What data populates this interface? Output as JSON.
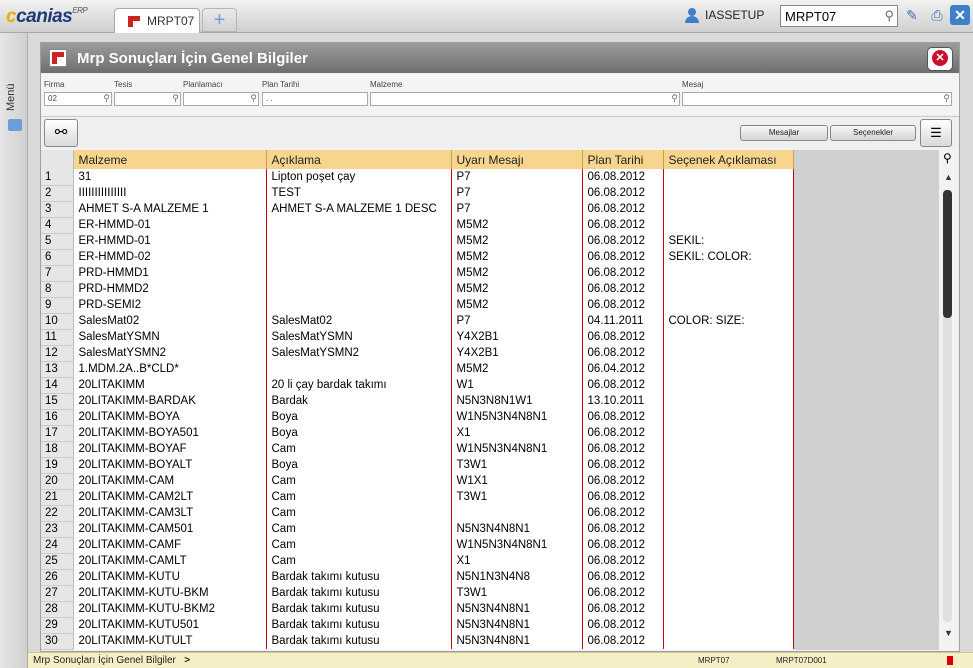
{
  "app": {
    "logo_main": "canias",
    "logo_sup": "ERP"
  },
  "tabs": [
    {
      "label": "MRPT07"
    }
  ],
  "add_tab_label": "+",
  "top": {
    "user": "IASSETUP",
    "search_value": "MRPT07"
  },
  "sidebar": {
    "menu_label": "Menü"
  },
  "window": {
    "title": "Mrp Sonuçları İçin Genel Bilgiler"
  },
  "filters": [
    {
      "label": "Firma",
      "value": "02"
    },
    {
      "label": "Tesis",
      "value": ""
    },
    {
      "label": "Planlamacı",
      "value": ""
    },
    {
      "label": "Plan Tarihi",
      "value": ". ."
    },
    {
      "label": "Malzeme",
      "value": ""
    },
    {
      "label": "Mesaj",
      "value": ""
    }
  ],
  "toolbar": {
    "messages_label": "Mesajlar",
    "options_label": "Seçenekler"
  },
  "grid": {
    "columns": [
      "",
      "Malzeme",
      "Açıklama",
      "Uyarı Mesajı",
      "Plan Tarihi",
      "Seçenek Açıklaması"
    ],
    "rows": [
      [
        "1",
        "31",
        "Lipton poşet çay",
        "P7",
        "06.08.2012",
        ""
      ],
      [
        "2",
        "IIIIIIIIIIIIIII",
        "TEST",
        "P7",
        "06.08.2012",
        ""
      ],
      [
        "3",
        "AHMET S-A MALZEME 1",
        "AHMET S-A MALZEME 1 DESC",
        "P7",
        "06.08.2012",
        ""
      ],
      [
        "4",
        "ER-HMMD-01",
        "",
        "M5M2",
        "06.08.2012",
        ""
      ],
      [
        "5",
        "ER-HMMD-01",
        "",
        "M5M2",
        "06.08.2012",
        "SEKIL:"
      ],
      [
        "6",
        "ER-HMMD-02",
        "",
        "M5M2",
        "06.08.2012",
        "SEKIL:   COLOR:"
      ],
      [
        "7",
        "PRD-HMMD1",
        "",
        "M5M2",
        "06.08.2012",
        ""
      ],
      [
        "8",
        "PRD-HMMD2",
        "",
        "M5M2",
        "06.08.2012",
        ""
      ],
      [
        "9",
        "PRD-SEMI2",
        "",
        "M5M2",
        "06.08.2012",
        ""
      ],
      [
        "10",
        "SalesMat02",
        "SalesMat02",
        "P7",
        "04.11.2011",
        "COLOR:   SIZE:"
      ],
      [
        "11",
        "SalesMatYSMN",
        "SalesMatYSMN",
        "Y4X2B1",
        "06.08.2012",
        ""
      ],
      [
        "12",
        "SalesMatYSMN2",
        "SalesMatYSMN2",
        "Y4X2B1",
        "06.08.2012",
        ""
      ],
      [
        "13",
        "1.MDM.2A..B*CLD*",
        "",
        "M5M2",
        "06.04.2012",
        ""
      ],
      [
        "14",
        "20LITAKIMM",
        "20 li çay bardak takımı",
        "W1",
        "06.08.2012",
        ""
      ],
      [
        "15",
        "20LITAKIMM-BARDAK",
        "Bardak",
        "N5N3N8N1W1",
        "13.10.2011",
        ""
      ],
      [
        "16",
        "20LITAKIMM-BOYA",
        "Boya",
        "W1N5N3N4N8N1",
        "06.08.2012",
        ""
      ],
      [
        "17",
        "20LITAKIMM-BOYA501",
        "Boya",
        "X1",
        "06.08.2012",
        ""
      ],
      [
        "18",
        "20LITAKIMM-BOYAF",
        "Cam",
        "W1N5N3N4N8N1",
        "06.08.2012",
        ""
      ],
      [
        "19",
        "20LITAKIMM-BOYALT",
        "Boya",
        "T3W1",
        "06.08.2012",
        ""
      ],
      [
        "20",
        "20LITAKIMM-CAM",
        "Cam",
        "W1X1",
        "06.08.2012",
        ""
      ],
      [
        "21",
        "20LITAKIMM-CAM2LT",
        "Cam",
        "T3W1",
        "06.08.2012",
        ""
      ],
      [
        "22",
        "20LITAKIMM-CAM3LT",
        "Cam",
        "",
        "06.08.2012",
        ""
      ],
      [
        "23",
        "20LITAKIMM-CAM501",
        "Cam",
        "N5N3N4N8N1",
        "06.08.2012",
        ""
      ],
      [
        "24",
        "20LITAKIMM-CAMF",
        "Cam",
        "W1N5N3N4N8N1",
        "06.08.2012",
        ""
      ],
      [
        "25",
        "20LITAKIMM-CAMLT",
        "Cam",
        "X1",
        "06.08.2012",
        ""
      ],
      [
        "26",
        "20LITAKIMM-KUTU",
        "Bardak takımı kutusu",
        "N5N1N3N4N8",
        "06.08.2012",
        ""
      ],
      [
        "27",
        "20LITAKIMM-KUTU-BKM",
        "Bardak takımı kutusu",
        "T3W1",
        "06.08.2012",
        ""
      ],
      [
        "28",
        "20LITAKIMM-KUTU-BKM2",
        "Bardak takımı kutusu",
        "N5N3N4N8N1",
        "06.08.2012",
        ""
      ],
      [
        "29",
        "20LITAKIMM-KUTU501",
        "Bardak takımı kutusu",
        "N5N3N4N8N1",
        "06.08.2012",
        ""
      ],
      [
        "30",
        "20LITAKIMM-KUTULT",
        "Bardak takımı kutusu",
        "N5N3N4N8N1",
        "06.08.2012",
        ""
      ]
    ]
  },
  "status": {
    "text": "Mrp Sonuçları İçin Genel Bilgiler",
    "arrow": ">",
    "module": "MRPT07",
    "form": "MRPT07D001"
  }
}
